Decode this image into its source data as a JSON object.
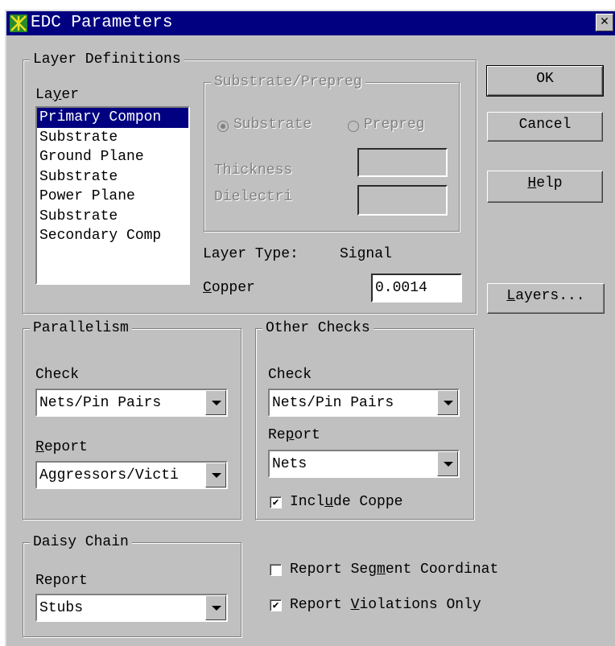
{
  "window": {
    "title": "EDC Parameters",
    "close_label": "✕"
  },
  "buttons": {
    "ok": "OK",
    "cancel": "Cancel",
    "help": "Help",
    "layers": "Layers..."
  },
  "layer_definitions": {
    "legend": "Layer Definitions",
    "layer_label": "Layer",
    "layers": [
      "Primary Compon",
      "Substrate",
      "Ground Plane",
      "Substrate",
      "Power Plane",
      "Substrate",
      "Secondary Comp"
    ],
    "selected_index": 0,
    "substrate_group": {
      "legend": "Substrate/Prepreg",
      "radio_substrate": "Substrate",
      "radio_prepreg": "Prepreg",
      "thickness_label": "Thickness",
      "dielectric_label": "Dielectri",
      "thickness_value": "",
      "dielectric_value": ""
    },
    "layer_type_label": "Layer Type:",
    "layer_type_value": "Signal",
    "copper_label": "Copper",
    "copper_value": "0.0014"
  },
  "parallelism": {
    "legend": "Parallelism",
    "check_label": "Check",
    "check_value": "Nets/Pin Pairs",
    "report_label": "Report",
    "report_value": "Aggressors/Victi"
  },
  "other_checks": {
    "legend": "Other Checks",
    "check_label": "Check",
    "check_value": "Nets/Pin Pairs",
    "report_label": "Report",
    "report_value": "Nets",
    "include_copper_label": "Include Coppe",
    "include_copper_checked": true
  },
  "daisy_chain": {
    "legend": "Daisy Chain",
    "report_label": "Report",
    "report_value": "Stubs"
  },
  "options": {
    "report_segment_label": "Report Segment Coordinat",
    "report_segment_checked": false,
    "report_violations_label": "Report Violations Only",
    "report_violations_checked": true
  },
  "icons": {
    "app": "edc-app-icon",
    "dropdown": "dropdown-arrow-icon",
    "check": "check-mark-icon"
  }
}
